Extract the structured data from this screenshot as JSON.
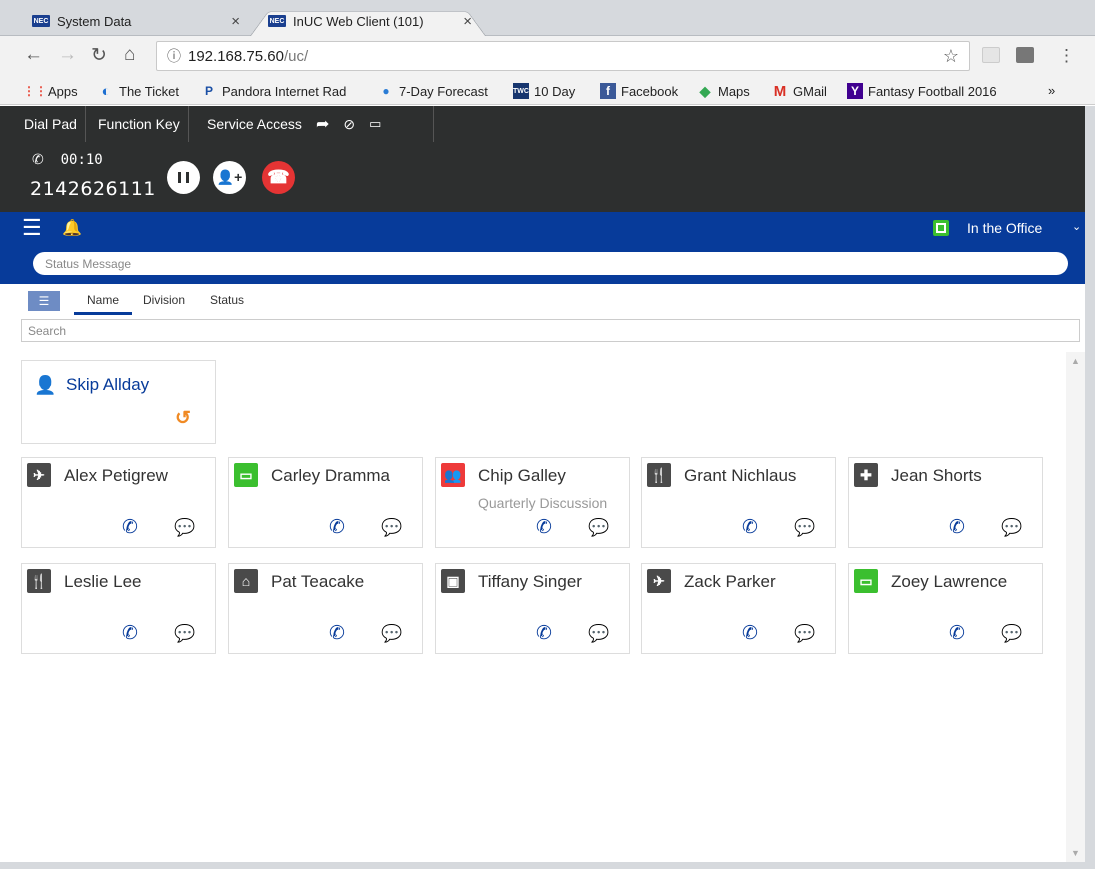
{
  "browser": {
    "tabs": [
      {
        "favicon": "NEC",
        "title": "System Data",
        "close": "×"
      },
      {
        "favicon": "NEC",
        "title": "InUC Web Client (101)",
        "close": "×"
      }
    ],
    "url_host": "192.168.75.60",
    "url_path": "/uc/",
    "bookmarks": [
      "Apps",
      "The Ticket",
      "Pandora Internet Rad",
      "7-Day Forecast",
      "10 Day",
      "Facebook",
      "Maps",
      "GMail",
      "Fantasy Football 2016"
    ],
    "bookmarks_more": "»"
  },
  "appbar": {
    "items": [
      "Dial Pad",
      "Function Key",
      "Service Access"
    ]
  },
  "call": {
    "timer": "00:10",
    "number": "2142626111"
  },
  "presence": {
    "status": "In the Office",
    "status_placeholder": "Status Message"
  },
  "list": {
    "tabs": [
      "Name",
      "Division",
      "Status"
    ],
    "search_placeholder": "Search"
  },
  "self_card": {
    "name": "Skip Allday"
  },
  "contacts": [
    {
      "name": "Alex Petigrew",
      "sub": "",
      "icon": "airplane-icon",
      "color": "#4a4a4a"
    },
    {
      "name": "Carley Dramma",
      "sub": "",
      "icon": "monitor-icon",
      "color": "#3bbf2f"
    },
    {
      "name": "Chip Galley",
      "sub": "Quarterly Discussion",
      "icon": "meeting-icon",
      "color": "#ee3a3a"
    },
    {
      "name": "Grant Nichlaus",
      "sub": "",
      "icon": "utensils-icon",
      "color": "#4a4a4a"
    },
    {
      "name": "Jean Shorts",
      "sub": "",
      "icon": "medical-icon",
      "color": "#4a4a4a"
    },
    {
      "name": "Leslie Lee",
      "sub": "",
      "icon": "utensils-icon",
      "color": "#4a4a4a"
    },
    {
      "name": "Pat Teacake",
      "sub": "",
      "icon": "home-icon",
      "color": "#4a4a4a"
    },
    {
      "name": "Tiffany Singer",
      "sub": "",
      "icon": "calendar-icon",
      "color": "#4a4a4a"
    },
    {
      "name": "Zack Parker",
      "sub": "",
      "icon": "airplane-icon",
      "color": "#4a4a4a"
    },
    {
      "name": "Zoey Lawrence",
      "sub": "",
      "icon": "monitor-icon",
      "color": "#3bbf2f"
    }
  ]
}
